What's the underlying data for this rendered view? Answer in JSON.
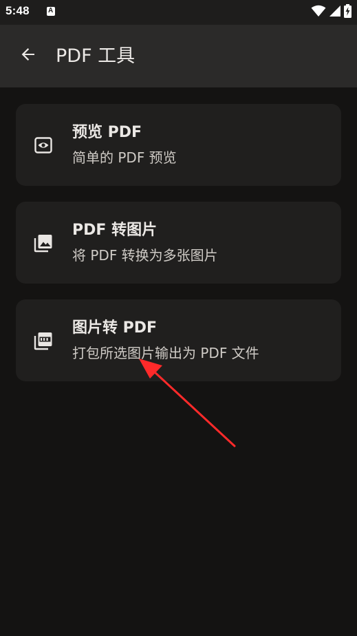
{
  "status_bar": {
    "time": "5:48",
    "icons": [
      "notification-a-icon",
      "wifi-icon",
      "signal-icon",
      "battery-charging-icon"
    ]
  },
  "app_bar": {
    "back_icon": "arrow-back-icon",
    "title": "PDF 工具"
  },
  "tools": [
    {
      "icon": "eye-preview-icon",
      "title": "预览 PDF",
      "subtitle": "简单的 PDF 预览"
    },
    {
      "icon": "image-stack-icon",
      "title": "PDF 转图片",
      "subtitle": "将 PDF 转换为多张图片"
    },
    {
      "icon": "pdf-stack-icon",
      "title": "图片转 PDF",
      "subtitle": "打包所选图片输出为 PDF 文件"
    }
  ],
  "annotation": {
    "arrow_color": "#ff2a2a"
  },
  "colors": {
    "background": "#141312",
    "app_bar": "#2b2a29",
    "status_bar": "#1e1d1c",
    "card": "#201f1e"
  }
}
